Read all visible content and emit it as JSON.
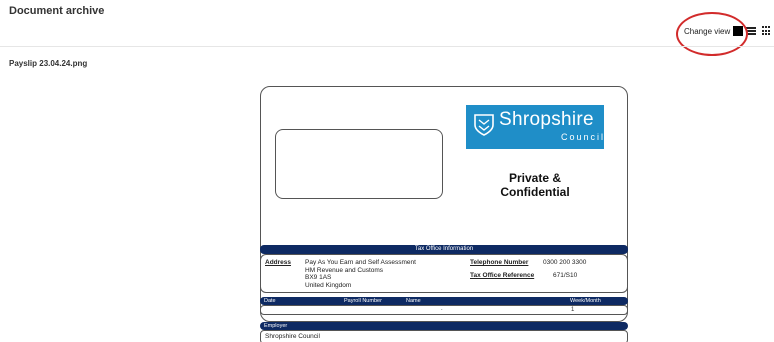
{
  "page": {
    "title": "Document archive",
    "change_view_label": "Change view",
    "view_options": [
      "single-view-icon",
      "list-view-icon",
      "grid-view-icon"
    ],
    "filename": "Payslip 23.04.24.png"
  },
  "payslip": {
    "logo": {
      "name": "Shropshire",
      "sub": "Council",
      "color": "#1f8ec8"
    },
    "confidential_line1": "Private &",
    "confidential_line2": "Confidential",
    "tax_office": {
      "title": "Tax Office Information",
      "address_label": "Address",
      "address_lines": [
        "Pay As You Earn and Self Assessment",
        "HM Revenue and Customs",
        "BX9 1AS",
        "United Kingdom"
      ],
      "telephone_label": "Telephone Number",
      "telephone_value": "0300 200 3300",
      "reference_label": "Tax Office Reference",
      "reference_value": "671/S10"
    },
    "pay_table": {
      "headers": [
        "Date",
        "Payroll Number",
        "Name",
        "Week/Month"
      ],
      "row": {
        "separator": ".",
        "week_month": "1"
      }
    },
    "employer": {
      "label": "Employer",
      "value": "Shropshire Council"
    },
    "header_color": "#0e2a63"
  },
  "annotation": {
    "circle_color": "#d22b2b"
  }
}
